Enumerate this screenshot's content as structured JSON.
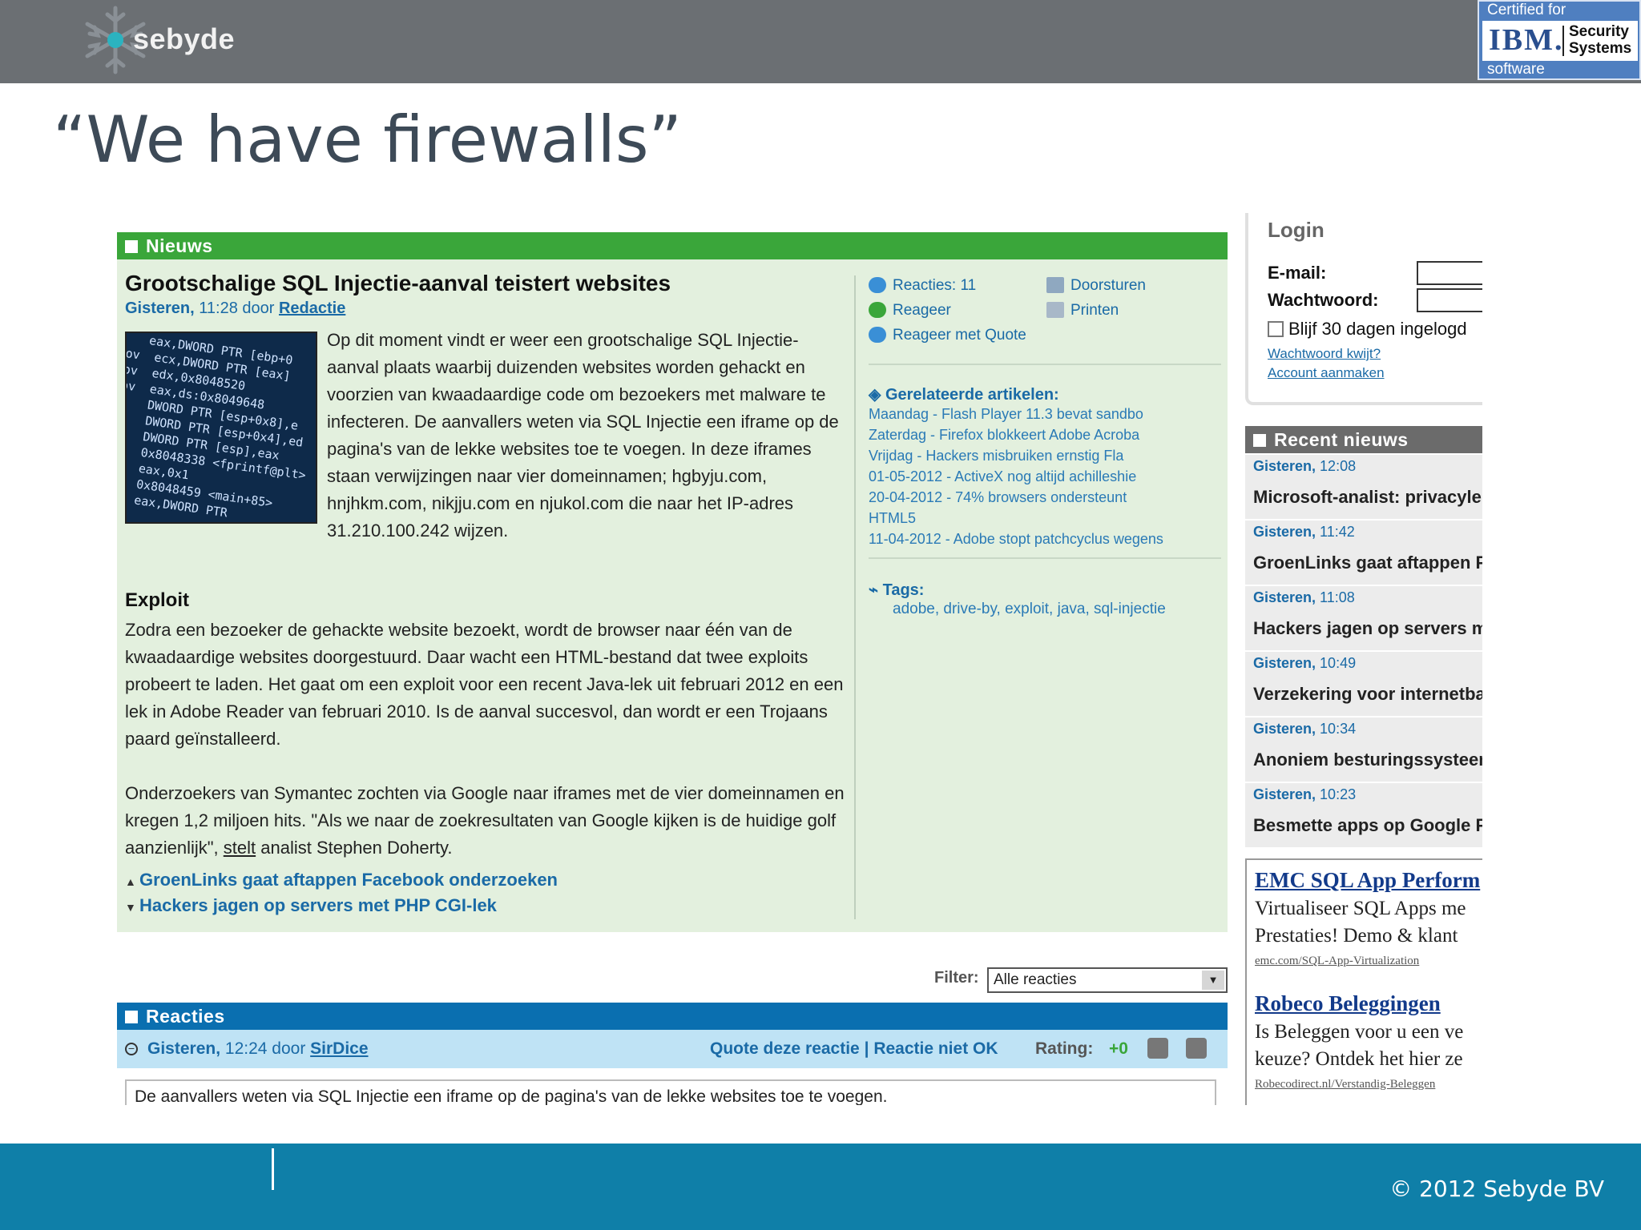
{
  "slide": {
    "brand": "sebyde",
    "title": "“We have firewalls”",
    "copyright": "©  2012 Sebyde BV",
    "ibm_badge": {
      "top": "Certified for",
      "logo": "IBM.",
      "line1": "Security",
      "line2": "Systems",
      "bottom": "software"
    }
  },
  "news": {
    "header": "Nieuws",
    "title": "Grootschalige SQL Injectie-aanval teistert websites",
    "byline_day": "Gisteren,",
    "byline_time": "11:28 door",
    "byline_author": "Redactie",
    "image_code": "    eax,DWORD PTR [ebp+0\nmov  ecx,DWORD PTR [eax]\nmov  edx,0x8048520\nmov  eax,ds:0x8049648\nov   DWORD PTR [esp+0x8],e\nov   DWORD PTR [esp+0x4],ed\nv    DWORD PTR [esp],eax\nl    0x8048338 <fprintf@plt>\n     eax,0x1\n     0x8048459 <main+85>\n     eax,DWORD PTR",
    "para1": "Op dit moment vindt er weer een grootschalige SQL Injectie-aanval plaats waarbij duizenden websites worden gehackt en voorzien van kwaadaardige code om bezoekers met malware te infecteren. De aanvallers weten via SQL Injectie een iframe op de pagina's van de lekke websites toe te voegen. In deze iframes staan verwijzingen naar vier domeinnamen; hgbyju.com, hnjhkm.com, nikjju.com en njukol.com die naar het IP-adres 31.210.100.242 wijzen.",
    "subheading": "Exploit",
    "para2": "Zodra een bezoeker de gehackte website bezoekt, wordt de browser naar één van de kwaadaardige websites doorgestuurd. Daar wacht een HTML-bestand dat twee exploits probeert te laden. Het gaat om een exploit voor een recent Java-lek uit februari 2012 en een lek in Adobe Reader van februari 2010. Is de aanval succesvol, dan wordt er een Trojaans paard geïnstalleerd.",
    "para3_a": "Onderzoekers van Symantec zochten via Google naar iframes met de vier domeinnamen en kregen 1,2 miljoen hits. \"Als we naar de zoekresultaten van Google kijken is de huidige golf aanzienlijk\", ",
    "para3_link": "stelt",
    "para3_b": " analist Stephen Doherty.",
    "prev_link": "GroenLinks gaat aftappen Facebook onderzoeken",
    "next_link": "Hackers jagen op servers met PHP CGI-lek",
    "actions": {
      "reacties": "Reacties: 11",
      "doorsturen": "Doorsturen",
      "reageer": "Reageer",
      "printen": "Printen",
      "reageer_quote": "Reageer met Quote"
    },
    "related_header": "Gerelateerde artikelen:",
    "related": [
      "Maandag - Flash Player 11.3 bevat sandbo",
      "Zaterdag - Firefox blokkeert Adobe Acroba",
      "Vrijdag - Hackers misbruiken ernstig Fla",
      "01-05-2012 - ActiveX nog altijd achilleshie",
      "20-04-2012 - 74% browsers ondersteunt",
      "HTML5",
      "11-04-2012 - Adobe stopt patchcyclus wegens"
    ],
    "tags_header": "Tags:",
    "tags": "adobe, drive-by, exploit, java, sql-injectie"
  },
  "filter": {
    "label": "Filter:",
    "value": "Alle reacties"
  },
  "reacties": {
    "header": "Reacties",
    "day": "Gisteren,",
    "time": "12:24 door",
    "author": "SirDice",
    "quote": "Quote deze reactie",
    "sep": "|",
    "not_ok": "Reactie niet OK",
    "rating_label": "Rating:",
    "rating_value": "+0",
    "body": "De aanvallers weten via SQL Injectie een iframe op de pagina's van de lekke websites toe te voegen."
  },
  "login": {
    "title": "Login",
    "email_label": "E-mail:",
    "password_label": "Wachtwoord:",
    "remember": "Blijf 30 dagen ingelogd",
    "forgot": "Wachtwoord kwijt?",
    "create": "Account aanmaken"
  },
  "recent": {
    "header": "Recent nieuws",
    "items": [
      {
        "day": "Gisteren,",
        "time": "12:08",
        "title": "Microsoft-analist: privacyle"
      },
      {
        "day": "Gisteren,",
        "time": "11:42",
        "title": "GroenLinks gaat aftappen F"
      },
      {
        "day": "Gisteren,",
        "time": "11:08",
        "title": "Hackers jagen op servers m"
      },
      {
        "day": "Gisteren,",
        "time": "10:49",
        "title": "Verzekering voor internetba"
      },
      {
        "day": "Gisteren,",
        "time": "10:34",
        "title": "Anoniem besturingssysteem"
      },
      {
        "day": "Gisteren,",
        "time": "10:23",
        "title": "Besmette apps op Google P"
      }
    ]
  },
  "ads": [
    {
      "title": "EMC SQL App Perform",
      "line1": "Virtualiseer SQL Apps me",
      "line2": "Prestaties! Demo & klant",
      "url": "emc.com/SQL-App-Virtualization"
    },
    {
      "title": "Robeco Beleggingen",
      "line1": "Is Beleggen voor u een ve",
      "line2": "keuze? Ontdek het hier ze",
      "url": "Robecodirect.nl/Verstandig-Beleggen"
    }
  ]
}
